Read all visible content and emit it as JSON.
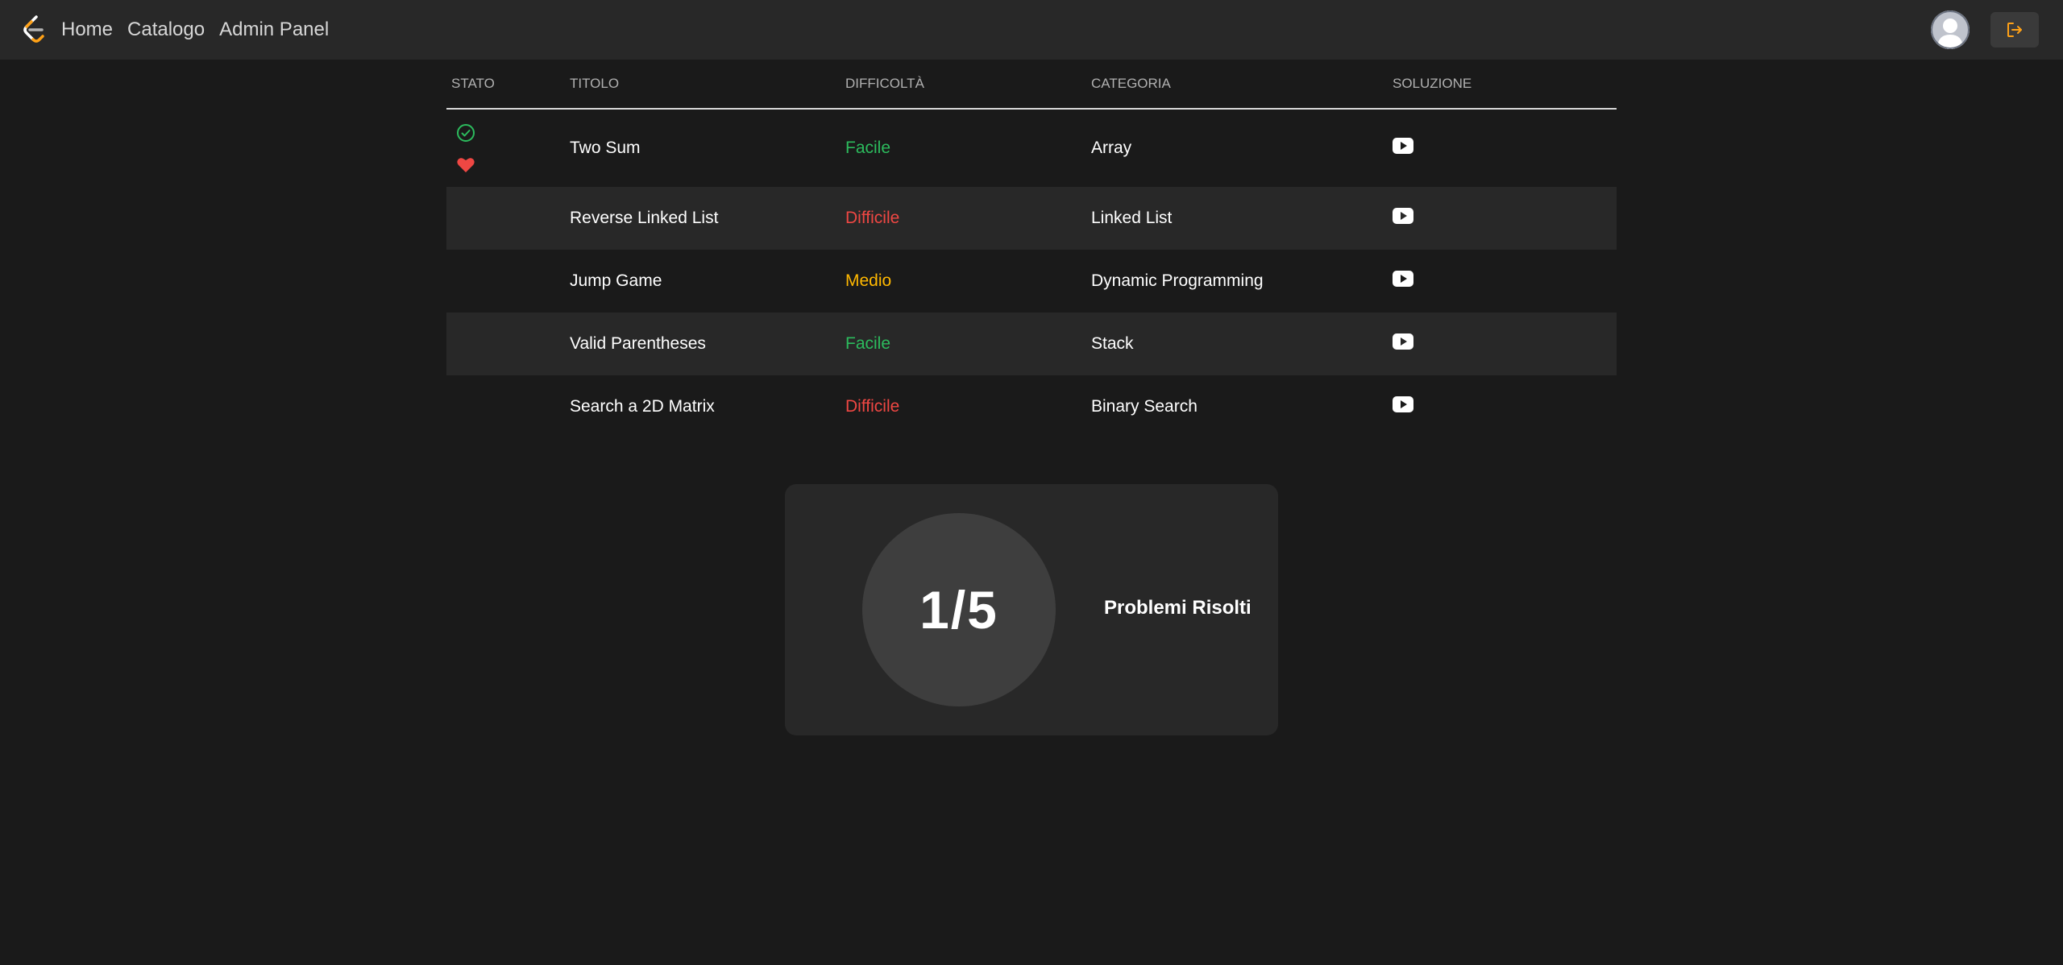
{
  "nav": {
    "links": [
      "Home",
      "Catalogo",
      "Admin Panel"
    ],
    "logo_icon": "leetcode-logo-icon",
    "avatar_icon": "user-avatar-icon",
    "logout_icon": "logout-icon",
    "accent_color": "#ffa116"
  },
  "table": {
    "headers": [
      "STATO",
      "TITOLO",
      "DIFFICOLTÀ",
      "CATEGORIA",
      "SOLUZIONE"
    ],
    "rows": [
      {
        "title": "Two Sum",
        "difficulty": "Facile",
        "category": "Array",
        "solved": true,
        "favorite": true
      },
      {
        "title": "Reverse Linked List",
        "difficulty": "Difficile",
        "category": "Linked List",
        "solved": false,
        "favorite": false
      },
      {
        "title": "Jump Game",
        "difficulty": "Medio",
        "category": "Dynamic Programming",
        "solved": false,
        "favorite": false
      },
      {
        "title": "Valid Parentheses",
        "difficulty": "Facile",
        "category": "Stack",
        "solved": false,
        "favorite": false
      },
      {
        "title": "Search a 2D Matrix",
        "difficulty": "Difficile",
        "category": "Binary Search",
        "solved": false,
        "favorite": false
      }
    ],
    "colors": {
      "Facile": "#2cbb5d",
      "Medio": "#ffb800",
      "Difficile": "#ef4743",
      "solved_check": "#2cbb5d",
      "favorite_heart": "#ef4743"
    }
  },
  "stats": {
    "count": "1/5",
    "label": "Problemi Risolti"
  }
}
